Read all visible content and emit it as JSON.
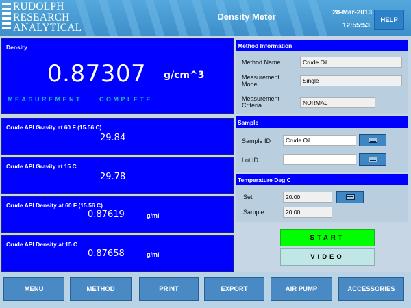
{
  "header": {
    "logo_lines": [
      "RUDOLPH",
      "RESEARCH",
      "ANALYTICAL"
    ],
    "title": "Density Meter",
    "date": "28-Mar-2013",
    "time": "12:55:53",
    "help_label": "HELP"
  },
  "density": {
    "label": "Density",
    "value": "0.87307",
    "unit": "g/cm^3",
    "status_word1": "MEASUREMENT",
    "status_word2": "COMPLETE"
  },
  "results": [
    {
      "label": "Crude API Gravity at 60 F (15.56 C)",
      "value": "29.84",
      "unit": ""
    },
    {
      "label": "Crude API Gravity at 15 C",
      "value": "29.78",
      "unit": ""
    },
    {
      "label": "Crude API Density at 60 F (15.56 C)",
      "value": "0.87619",
      "unit": "g/ml"
    },
    {
      "label": "Crude API Density at 15 C",
      "value": "0.87658",
      "unit": "g/ml"
    }
  ],
  "method": {
    "header": "Method Information",
    "name_label": "Method Name",
    "name_value": "Crude Oil",
    "mode_label": "Measurement Mode",
    "mode_value": "Single",
    "criteria_label": "Measurement Criteria",
    "criteria_value": "NORMAL"
  },
  "sample": {
    "header": "Sample",
    "id_label": "Sample ID",
    "id_value": "Crude Oil",
    "lot_label": "Lot ID",
    "lot_value": ""
  },
  "temperature": {
    "header": "Temperature Deg C",
    "set_label": "Set",
    "set_value": "20.00",
    "sample_label": "Sample",
    "sample_value": "20.00"
  },
  "actions": {
    "start": "START",
    "video": "VIDEO"
  },
  "footer": [
    "MENU",
    "METHOD",
    "PRINT",
    "EXPORT",
    "AIR PUMP",
    "ACCESSORIES"
  ],
  "colors": {
    "panel_blue": "#0000ff",
    "header_blue": "#3e8fca",
    "status_cyan": "#19c0c8",
    "start_green": "#00ff00",
    "video_cyan": "#c0e6e6",
    "footer_button": "#4a8ac4"
  },
  "icons": {
    "keyboard": "keyboard-icon"
  }
}
